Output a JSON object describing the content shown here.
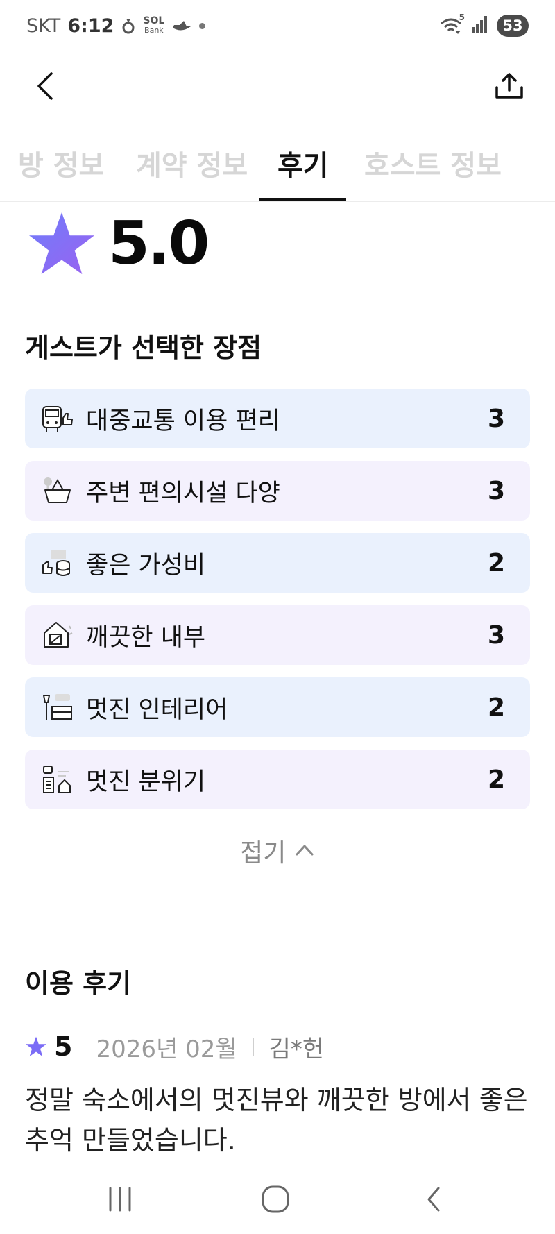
{
  "status_bar": {
    "carrier": "SKT",
    "time": "6:12",
    "app_icons": [
      "notification-icon",
      "sol-bank-icon",
      "boat-icon"
    ],
    "sol_text": "SOL",
    "bank_text": "Bank",
    "wifi_label": "5",
    "battery": "53"
  },
  "tabs": [
    {
      "label": "방 정보",
      "active": false
    },
    {
      "label": "계약 정보",
      "active": false
    },
    {
      "label": "후기",
      "active": true
    },
    {
      "label": "호스트 정보",
      "active": false
    }
  ],
  "rating": {
    "value": "5.0",
    "star_color": "#7b6cf6"
  },
  "pros_section": {
    "title": "게스트가 선택한 장점",
    "items": [
      {
        "label": "대중교통 이용 편리",
        "count": "3",
        "icon": "bus-thumbs-up-icon",
        "bg": "blue"
      },
      {
        "label": "주변 편의시설 다양",
        "count": "3",
        "icon": "shopping-basket-icon",
        "bg": "lavender"
      },
      {
        "label": "좋은 가성비",
        "count": "2",
        "icon": "coins-thumbs-up-icon",
        "bg": "blue"
      },
      {
        "label": "깨끗한 내부",
        "count": "3",
        "icon": "clean-house-icon",
        "bg": "lavender"
      },
      {
        "label": "멋진 인테리어",
        "count": "2",
        "icon": "lamp-sofa-icon",
        "bg": "blue"
      },
      {
        "label": "멋진 분위기",
        "count": "2",
        "icon": "neighborhood-icon",
        "bg": "lavender"
      }
    ],
    "fold_label": "접기",
    "colors": {
      "blue_bg": "#eaf1fd",
      "lavender_bg": "#f4f1fd"
    }
  },
  "reviews_section": {
    "title": "이용 후기",
    "reviews": [
      {
        "score": "5",
        "date": "2026년 02월",
        "author": "김*헌",
        "text": "정말 숙소에서의 멋진뷰와 깨끗한 방에서 좋은 추억 만들었습니다."
      }
    ]
  }
}
